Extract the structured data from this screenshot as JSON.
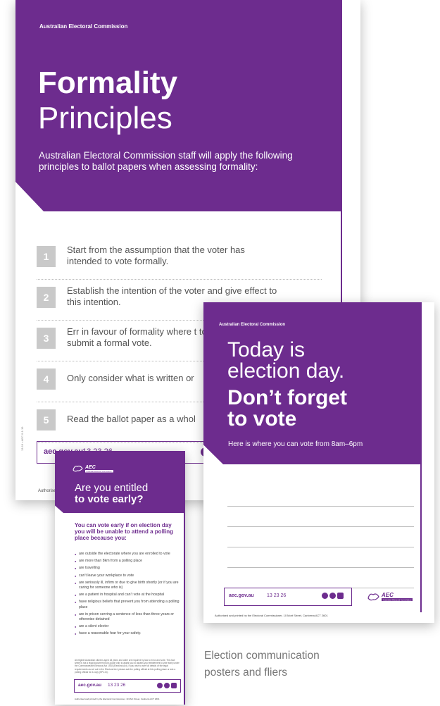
{
  "colors": {
    "purple": "#6d2c8e",
    "grey_box": "#c9c9c9"
  },
  "poster1": {
    "org": "Australian Electoral Commission",
    "title_bold": "Formality",
    "title_light": "Principles",
    "intro": "Australian Electoral Commission staff will apply the following principles to ballot papers when assessing formality:",
    "items": [
      {
        "num": "1",
        "text": "Start from the assumption that the voter has intended to vote formally."
      },
      {
        "num": "2",
        "text": "Establish the intention of the voter and give effect to this intention."
      },
      {
        "num": "3",
        "text": "Err in favour of formality where t to submit a formal vote."
      },
      {
        "num": "4",
        "text": "Only consider what is written or"
      },
      {
        "num": "5",
        "text": "Read the ballot paper as a whol"
      }
    ],
    "url": "aec.gov.au",
    "phone": "13 23 26",
    "authorised": "Authorised by the Electo",
    "code": "13-19 • AEC 0-1-19",
    "social_icons": [
      "facebook-icon",
      "twitter-icon"
    ]
  },
  "poster2": {
    "org": "Australian Electoral Commission",
    "line1": "Today is",
    "line2": "election day.",
    "line3": "Don’t forget",
    "line4": "to vote",
    "sub": "Here is where you can vote from 8am–6pm",
    "url": "aec.gov.au",
    "phone": "13 23 26",
    "authorised": "Authorised and printed by the Electoral Commissioner, 10 Mort Street, Canberra ACT 2601",
    "logo_text": "AEC",
    "logo_sub": "Australian Electoral Commission",
    "social_icons": [
      "facebook-icon",
      "twitter-icon",
      "instagram-icon"
    ]
  },
  "poster3": {
    "logo_text": "AEC",
    "logo_sub": "Australian Electoral Commission",
    "heading_light": "Are you entitled",
    "heading_bold": "to vote early?",
    "lead": "You can vote early if on election day you will be unable to attend a polling place because you:",
    "bullets": [
      "are outside the electorate where you are enrolled to vote",
      "are more than 8km from a polling place",
      "are travelling",
      "can’t leave your workplace to vote",
      "are seriously ill, infirm or due to give birth shortly (or if you are caring for someone who is)",
      "are a patient in hospital and can’t vote at the hospital",
      "have religious beliefs that prevent you from attending a polling place",
      "are in prison serving a sentence of less than three years or otherwise detained",
      "are a silent elector",
      "have a reasonable fear for your safety."
    ],
    "fine": "All eligible Australian citizens aged 18 years and older are required by law to enrol and vote. This fact sheet is not a legal document but a guide only to assist you to assess your entitlement to vote early under the Commonwealth Electoral Act 1918 (Electoral Act). If you wish to see full details of the legal requirements as set out in the Electoral Act, please ask the polling official at this polling place or ask a polling official for a copy (SPC-B).",
    "url": "aec.gov.au",
    "phone": "13 23 26",
    "authorised": "Authorised and printed by the Electoral Commissioner, 10 Mort Street, Canberra ACT 2601",
    "social_icons": [
      "facebook-icon",
      "twitter-icon",
      "instagram-icon"
    ]
  },
  "caption": {
    "line1": "Election communication",
    "line2": "posters and fliers"
  }
}
